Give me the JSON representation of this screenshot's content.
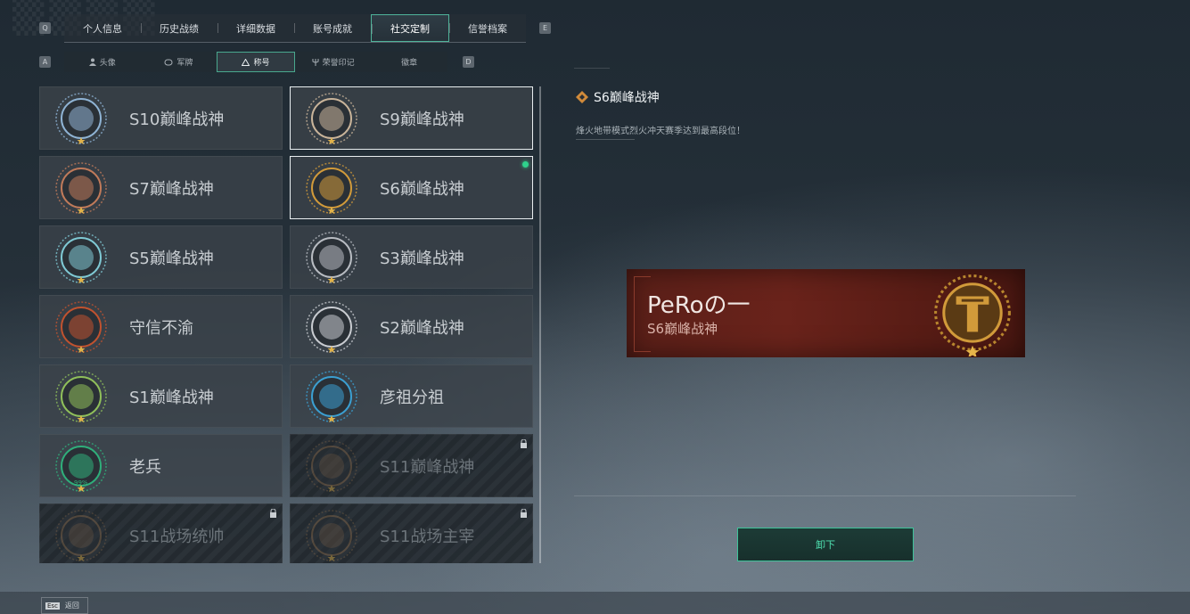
{
  "tabs": {
    "prev_key": "Q",
    "next_key": "E",
    "items": [
      {
        "label": "个人信息"
      },
      {
        "label": "历史战绩"
      },
      {
        "label": "详细数据"
      },
      {
        "label": "账号成就"
      },
      {
        "label": "社交定制",
        "active": true
      },
      {
        "label": "信誉档案"
      }
    ]
  },
  "subtabs": {
    "prev_key": "A",
    "next_key": "D",
    "items": [
      {
        "label": "头像",
        "icon": "person-icon"
      },
      {
        "label": "军牌",
        "icon": "dogtag-icon"
      },
      {
        "label": "称号",
        "icon": "triangle-icon",
        "active": true
      },
      {
        "label": "荣誉印记",
        "icon": "trident-icon"
      },
      {
        "label": "徽章",
        "icon": ""
      }
    ]
  },
  "titles": [
    {
      "label": "S10巅峰战神",
      "emblem": "tower-emblem",
      "color": "#8fb3d4"
    },
    {
      "label": "S9巅峰战神",
      "emblem": "fortress-emblem",
      "color": "#c9b49a",
      "selected": true
    },
    {
      "label": "S7巅峰战神",
      "emblem": "gun-emblem",
      "color": "#c07a5a"
    },
    {
      "label": "S6巅峰战神",
      "emblem": "t-shield-emblem",
      "color": "#d19a3a",
      "equipped": true,
      "selected": true
    },
    {
      "label": "S5巅峰战神",
      "emblem": "skull-emblem",
      "color": "#7fc9d4"
    },
    {
      "label": "S3巅峰战神",
      "emblem": "globe-emblem",
      "color": "#b8bcc2"
    },
    {
      "label": "守信不渝",
      "emblem": "scales-emblem",
      "color": "#c0522f"
    },
    {
      "label": "S2巅峰战神",
      "emblem": "triangle-emblem",
      "color": "#c9ccd1"
    },
    {
      "label": "S1巅峰战神",
      "emblem": "crocodile-emblem",
      "color": "#8fbf5a"
    },
    {
      "label": "彦祖分祖",
      "emblem": "portrait-emblem",
      "color": "#3b9fd1"
    },
    {
      "label": "老兵",
      "emblem": "veteran-emblem",
      "color": "#2fae7a",
      "sub": "99%"
    },
    {
      "label": "S11巅峰战神",
      "emblem": "airship-emblem",
      "color": "#8a6a4a",
      "locked": true
    },
    {
      "label": "S11战场统帅",
      "emblem": "tank-emblem",
      "color": "#8a6a4a",
      "locked": true
    },
    {
      "label": "S11战场主宰",
      "emblem": "gate-emblem",
      "color": "#8a6a4a",
      "locked": true
    }
  ],
  "detail": {
    "title": "S6巅峰战神",
    "description": "烽火地带模式烈火冲天赛季达到最高段位！",
    "banner_player": "PeRoの一",
    "banner_rank": "S6巅峰战神",
    "unequip_label": "卸下"
  },
  "footer": {
    "key": "Esc",
    "label": "返回"
  }
}
